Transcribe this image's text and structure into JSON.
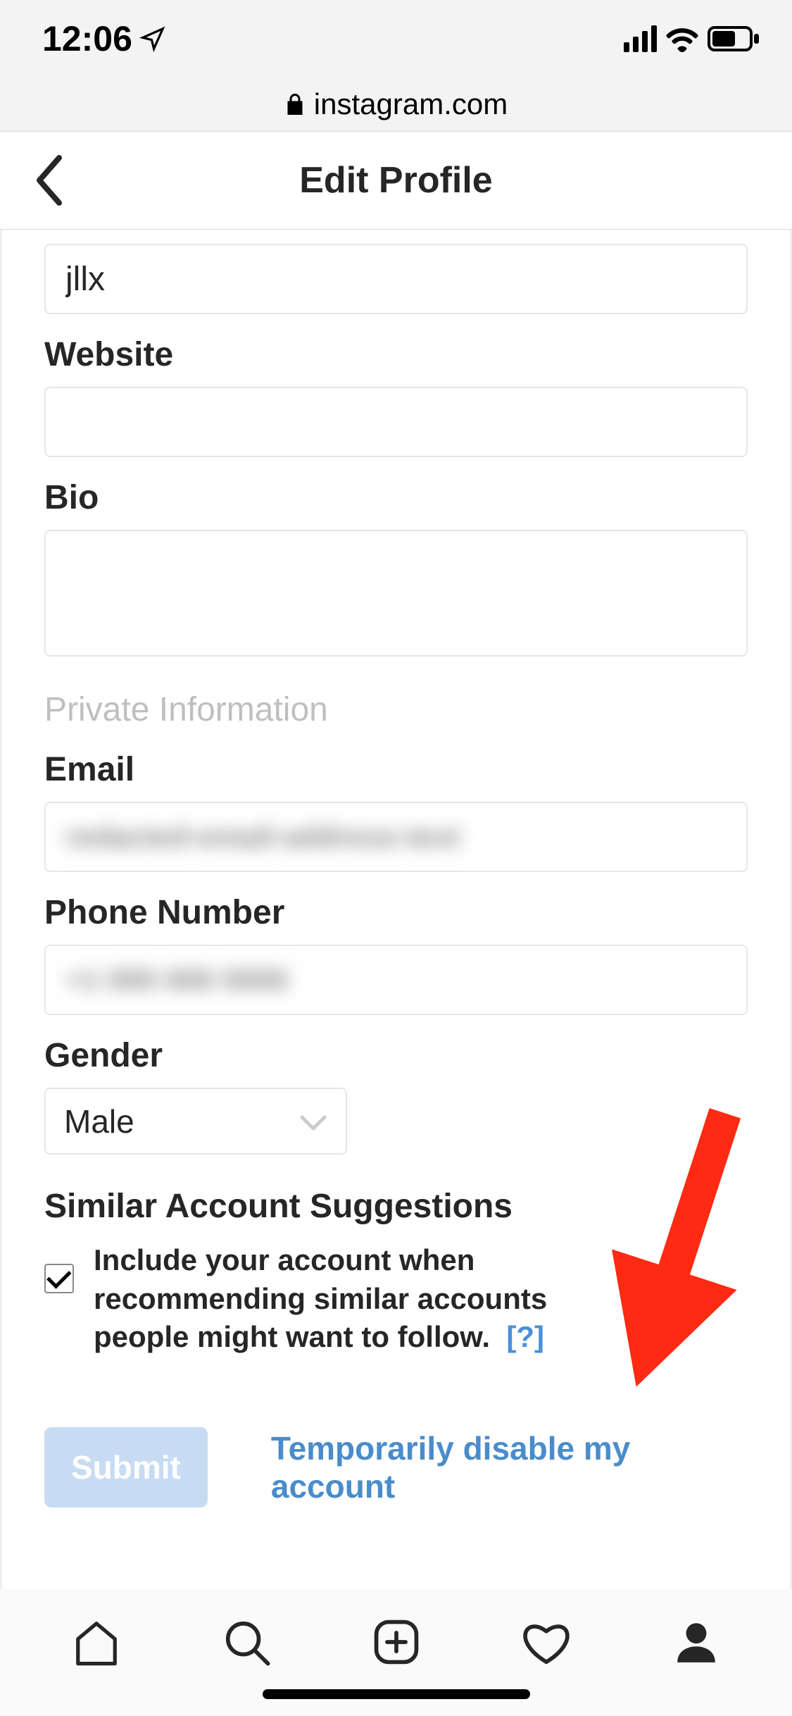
{
  "status": {
    "time": "12:06"
  },
  "browser": {
    "domain": "instagram.com"
  },
  "header": {
    "title": "Edit Profile"
  },
  "form": {
    "username_value": "jllx",
    "website_label": "Website",
    "website_value": "",
    "bio_label": "Bio",
    "bio_value": "",
    "private_heading": "Private Information",
    "email_label": "Email",
    "email_value": "",
    "phone_label": "Phone Number",
    "phone_value": "",
    "gender_label": "Gender",
    "gender_value": "Male",
    "suggest_heading": "Similar Account Suggestions",
    "suggest_text": "Include your account when recommending similar accounts people might want to follow.",
    "suggest_help": "[?]",
    "suggest_checked": true,
    "submit_label": "Submit",
    "disable_link": "Temporarily disable my account"
  }
}
